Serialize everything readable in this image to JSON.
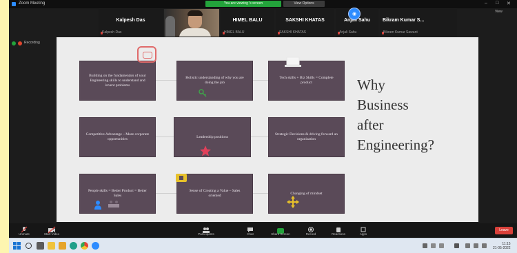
{
  "window": {
    "title": "Zoom Meeting",
    "banner_green": "You are viewing 's screen",
    "banner_grey": "View Options",
    "minimize": "–",
    "maximize": "□",
    "close": "✕"
  },
  "participants": [
    {
      "name": "Kalpesh Das",
      "sub": "Kalpesh Das"
    },
    {
      "name": "",
      "sub": ""
    },
    {
      "name": "HIMEL BALU",
      "sub": "HIMEL BALU"
    },
    {
      "name": "SAKSHI KHATAS",
      "sub": "SAKSHI KHATAS"
    },
    {
      "name": "Anjali Sahu",
      "sub": "Anjali Sahu"
    },
    {
      "name": "Bikram Kumar S...",
      "sub": "Bikram Kumar Sawant"
    }
  ],
  "status": {
    "left_label": "Recording",
    "right_label": "View"
  },
  "slide": {
    "heading_lines": [
      "Why",
      "Business",
      "after",
      "Engineering?"
    ],
    "boxes": [
      "Building on the fundamentals of your Engineering skills to understand and invent problems",
      "Holistic understanding of why you are doing the job",
      "Tech skills + Biz Skills = Complete product",
      "Competitive Advantage – More corporate opportunities",
      "Leadership positions",
      "Strategic Decisions & driving forward an organisation",
      "People skills = Better Product = Better Sales",
      "Sense of Creating a Value – Sales oriented",
      "Changing of mindset"
    ],
    "colors": {
      "box": "#5a4a58",
      "accent_red": "#e0405a",
      "accent_green": "#3fa34a",
      "accent_yellow": "#e7c12a",
      "accent_blue": "#2d8cff"
    },
    "icons": [
      "brain-icon",
      "key-icon",
      "laptop-icon",
      "star-icon",
      "chip-icon",
      "person-icon",
      "people-icon",
      "arrows-icon"
    ]
  },
  "toolbar": {
    "items": [
      {
        "label": "Unmute",
        "icon": "mic-off-icon"
      },
      {
        "label": "Start Video",
        "icon": "video-off-icon"
      },
      {
        "label": "Participants",
        "icon": "people-icon"
      },
      {
        "label": "Chat",
        "icon": "chat-icon"
      },
      {
        "label": "Share Screen",
        "icon": "share-screen-icon"
      },
      {
        "label": "Record",
        "icon": "record-icon"
      },
      {
        "label": "Reactions",
        "icon": "reactions-icon"
      },
      {
        "label": "Apps",
        "icon": "apps-icon"
      }
    ],
    "end_label": "Leave"
  },
  "taskbar": {
    "apps": [
      "search-icon",
      "task-view-icon",
      "file-explorer-icon",
      "folder-icon",
      "edge-icon",
      "chrome-icon",
      "zoom-icon"
    ],
    "time": "11:15",
    "date": "21-05-2022"
  }
}
